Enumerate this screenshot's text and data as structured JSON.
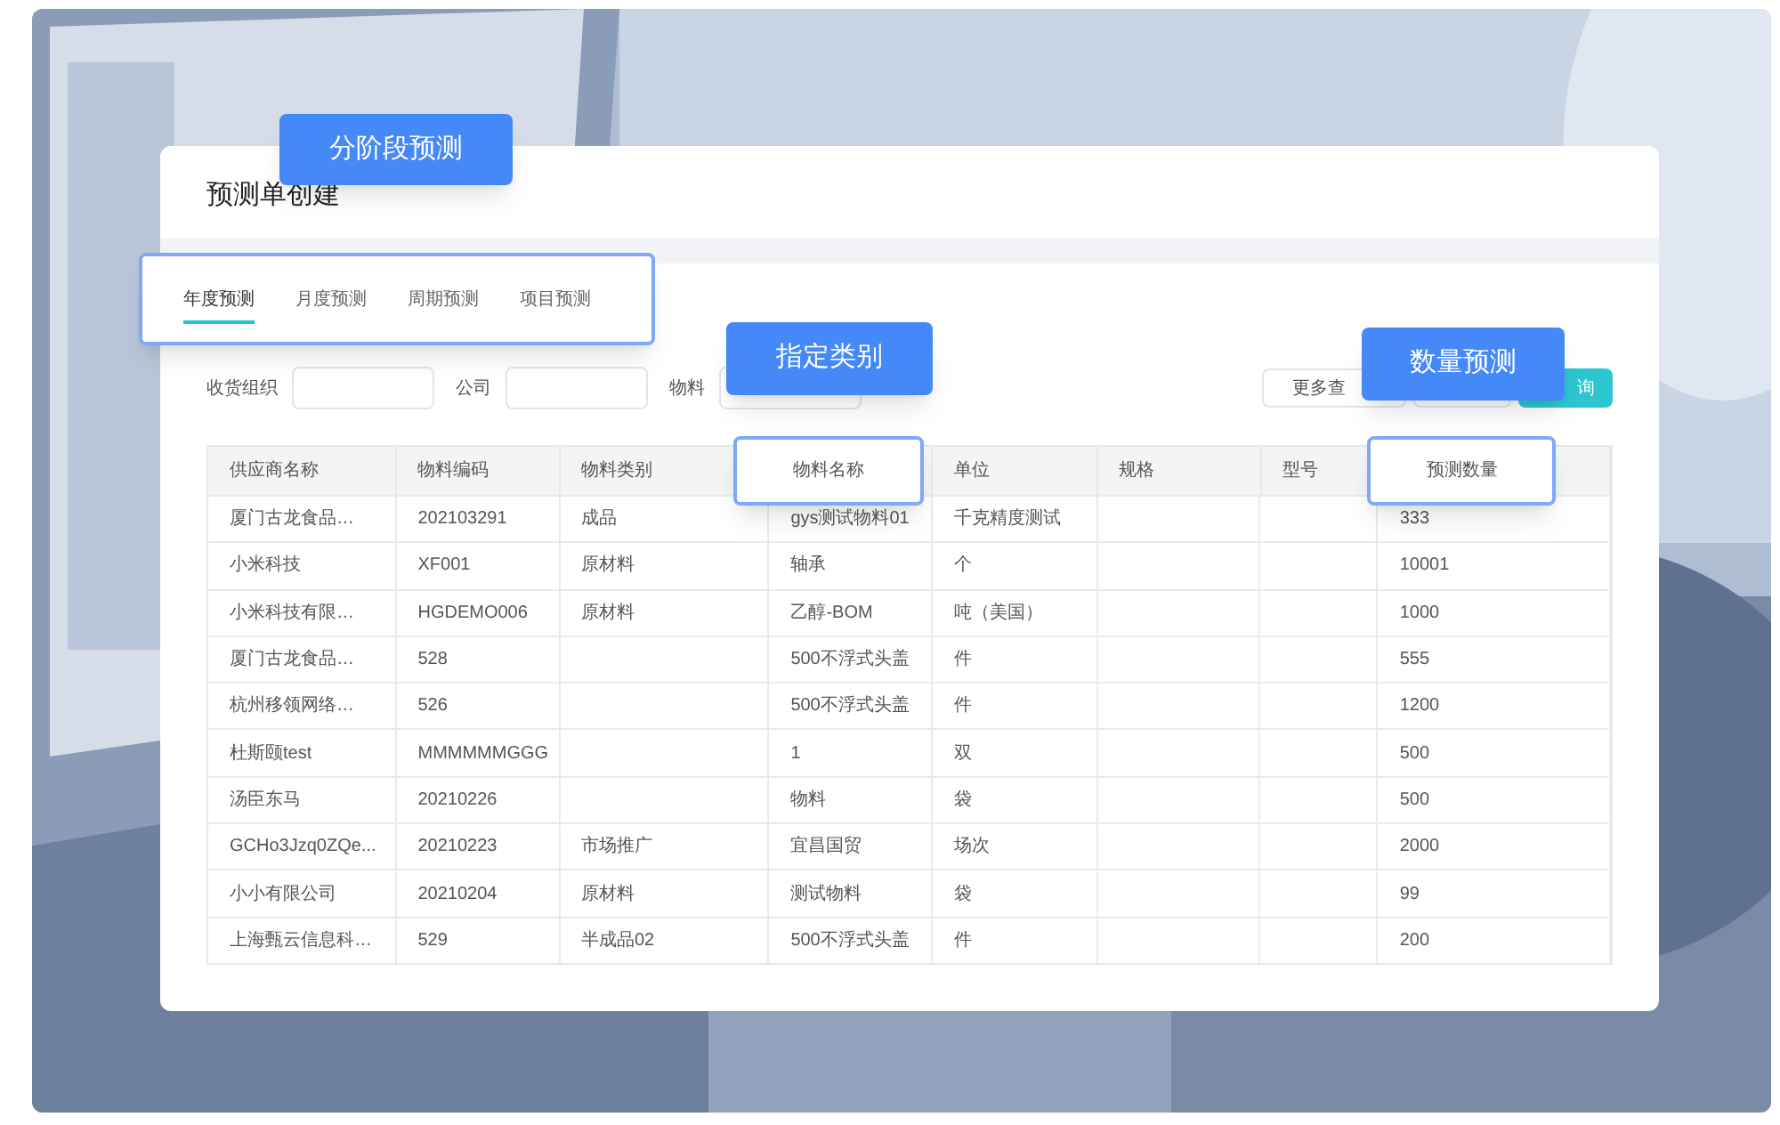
{
  "callouts": [
    {
      "label": "分阶段预测"
    },
    {
      "label": "指定类别"
    },
    {
      "label": "数量预测"
    }
  ],
  "page": {
    "title": "预测单创建"
  },
  "tabs": [
    {
      "label": "年度预测",
      "selected": true
    },
    {
      "label": "月度预测",
      "selected": false
    },
    {
      "label": "周期预测",
      "selected": false
    },
    {
      "label": "项目预测",
      "selected": false
    }
  ],
  "filters": [
    {
      "label": "收货组织"
    },
    {
      "label": "公司"
    },
    {
      "label": "物料"
    }
  ],
  "buttons": [
    {
      "label": "更多查",
      "kind": "outline"
    },
    {
      "kind": "outline"
    },
    {
      "label": "询",
      "kind": "primary"
    }
  ],
  "table": {
    "columns": [
      {
        "label": "供应商名称",
        "highlighted": false
      },
      {
        "label": "物料编码",
        "highlighted": false
      },
      {
        "label": "物料类别",
        "highlighted": false
      },
      {
        "label": "物料名称",
        "highlighted": true
      },
      {
        "label": "单位",
        "highlighted": false
      },
      {
        "label": "规格",
        "highlighted": false
      },
      {
        "label": "型号",
        "highlighted": false
      },
      {
        "label": "预测数量",
        "highlighted": true
      }
    ],
    "rows": [
      [
        "厦门古龙食品…",
        "202103291",
        "成品",
        "gys测试物料01",
        "千克精度测试",
        "",
        "",
        "333"
      ],
      [
        "小米科技",
        "XF001",
        "原材料",
        "轴承",
        "个",
        "",
        "",
        "10001"
      ],
      [
        "小米科技有限…",
        "HGDEMO006",
        "原材料",
        "乙醇-BOM",
        "吨（美国）",
        "",
        "",
        "1000"
      ],
      [
        "厦门古龙食品…",
        "528",
        "",
        "500不浮式头盖",
        "件",
        "",
        "",
        "555"
      ],
      [
        "杭州移领网络…",
        "526",
        "",
        "500不浮式头盖",
        "件",
        "",
        "",
        "1200"
      ],
      [
        "杜斯颐test",
        "MMMMMMGGG",
        "",
        "1",
        "双",
        "",
        "",
        "500"
      ],
      [
        "汤臣东马",
        "20210226",
        "",
        "物料",
        "袋",
        "",
        "",
        "500"
      ],
      [
        "GCHo3Jzq0ZQe...",
        "20210223",
        "市场推广",
        "宜昌国贸",
        "场次",
        "",
        "",
        "2000"
      ],
      [
        "小小有限公司",
        "20210204",
        "原材料",
        "测试物料",
        "袋",
        "",
        "",
        "99"
      ],
      [
        "上海甄云信息科…",
        "529",
        "半成品02",
        "500不浮式头盖",
        "件",
        "",
        "",
        "200"
      ]
    ]
  }
}
